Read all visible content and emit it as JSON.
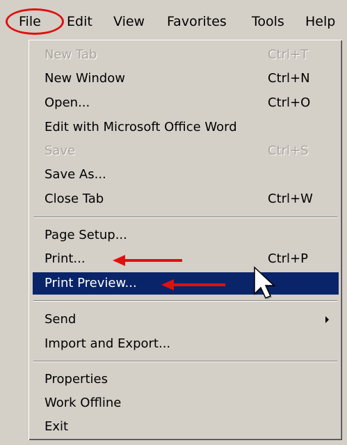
{
  "menubar": {
    "items": [
      "File",
      "Edit",
      "View",
      "Favorites",
      "Tools",
      "Help"
    ]
  },
  "file_menu": {
    "items": [
      {
        "label": "New Tab",
        "shortcut": "Ctrl+T",
        "disabled": true
      },
      {
        "label": "New Window",
        "shortcut": "Ctrl+N"
      },
      {
        "label": "Open...",
        "shortcut": "Ctrl+O"
      },
      {
        "label": "Edit with Microsoft Office Word",
        "shortcut": ""
      },
      {
        "label": "Save",
        "shortcut": "Ctrl+S",
        "disabled": true
      },
      {
        "label": "Save As...",
        "shortcut": ""
      },
      {
        "label": "Close Tab",
        "shortcut": "Ctrl+W"
      },
      {
        "label": "Page Setup...",
        "shortcut": ""
      },
      {
        "label": "Print...",
        "shortcut": "Ctrl+P"
      },
      {
        "label": "Print Preview...",
        "shortcut": "",
        "highlighted": true
      },
      {
        "label": "Send",
        "shortcut": "",
        "submenu": true
      },
      {
        "label": "Import and Export...",
        "shortcut": ""
      },
      {
        "label": "Properties",
        "shortcut": ""
      },
      {
        "label": "Work Offline",
        "shortcut": ""
      },
      {
        "label": "Exit",
        "shortcut": ""
      }
    ]
  },
  "colors": {
    "menu_background": "#d4d0c8",
    "highlight": "#0a246a",
    "annotation_red": "#e01010",
    "disabled_text": "#a8a49c"
  },
  "icons": [
    "chevron-right-icon",
    "red-arrow-icon",
    "mouse-pointer-icon"
  ]
}
